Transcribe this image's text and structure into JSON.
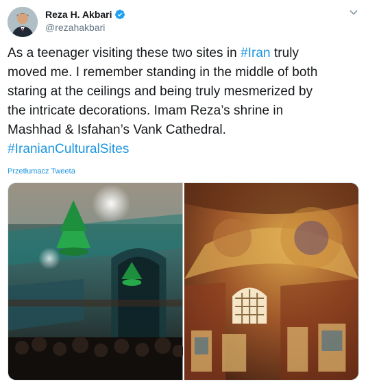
{
  "author": {
    "display_name": "Reza H. Akbari",
    "handle": "@rezahakbari",
    "verified": true,
    "avatar_icon": "profile-photo"
  },
  "menu_icon": "chevron-down-icon",
  "tweet": {
    "lines": [
      [
        {
          "text": "As a teenager visiting these two sites in "
        },
        {
          "text": "#Iran",
          "tag": true
        },
        {
          "text": " truly"
        }
      ],
      [
        {
          "text": "moved me. I remember standing in the middle of both"
        }
      ],
      [
        {
          "text": "staring at the ceilings and being truly mesmerized by"
        }
      ],
      [
        {
          "text": "the intricate decorations. Imam Reza’s shrine in"
        }
      ],
      [
        {
          "text": "Mashhad & Isfahan’s Vank Cathedral."
        }
      ],
      [
        {
          "text": "#IranianCulturalSites",
          "tag": true
        }
      ]
    ]
  },
  "translate_label": "Przetłumacz Tweeta",
  "media": {
    "photos": [
      {
        "name": "photo-imam-reza-shrine"
      },
      {
        "name": "photo-vank-cathedral"
      }
    ]
  },
  "colors": {
    "link": "#1b95e0",
    "verified": "#1da1f2",
    "secondary_text": "#657786"
  }
}
